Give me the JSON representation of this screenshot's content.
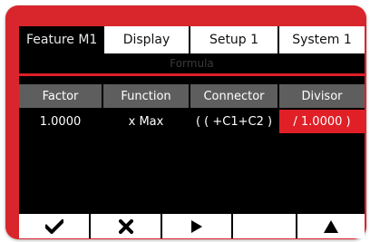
{
  "tabs": [
    {
      "label": "Feature  M1",
      "active": true
    },
    {
      "label": "Display",
      "active": false
    },
    {
      "label": "Setup 1",
      "active": false
    },
    {
      "label": "System 1",
      "active": false
    }
  ],
  "subtitle": "Formula",
  "table": {
    "headers": [
      "Factor",
      "Function",
      "Connector",
      "Divisor"
    ],
    "row": [
      "1.0000",
      "x Max",
      "( ( +C1+C2 )",
      "/ 1.0000 )"
    ],
    "selected_index": 3
  },
  "buttons": [
    {
      "icon": "check-icon"
    },
    {
      "icon": "close-icon"
    },
    {
      "icon": "play-icon"
    },
    {
      "icon": ""
    },
    {
      "icon": "up-arrow-icon"
    }
  ],
  "colors": {
    "accent": "#e01f26",
    "header_bg": "#5e5e5e",
    "screen_bg": "#000000",
    "bezel": "#d8262c"
  }
}
